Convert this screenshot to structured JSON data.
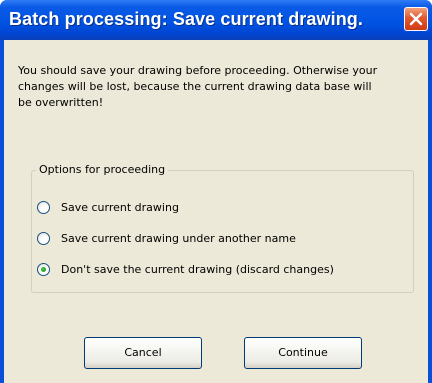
{
  "window": {
    "title": "Batch processing: Save current drawing."
  },
  "message": {
    "text": "You should save your drawing before proceeding. Otherwise your\nchanges will be lost, because the current drawing data base will\nbe overwritten!"
  },
  "options": {
    "group_label": "Options for proceeding",
    "items": [
      {
        "label": "Save current drawing",
        "selected": false
      },
      {
        "label": "Save current drawing under another name",
        "selected": false
      },
      {
        "label": "Don't save the current drawing (discard changes)",
        "selected": true
      }
    ]
  },
  "buttons": {
    "cancel_label": "Cancel",
    "continue_label": "Continue"
  },
  "colors": {
    "titlebar": "#0054e3",
    "close_button": "#e2572e",
    "dialog_background": "#ece9d8",
    "radio_selected": "#21a121"
  },
  "icons": {
    "close": "close-icon"
  }
}
